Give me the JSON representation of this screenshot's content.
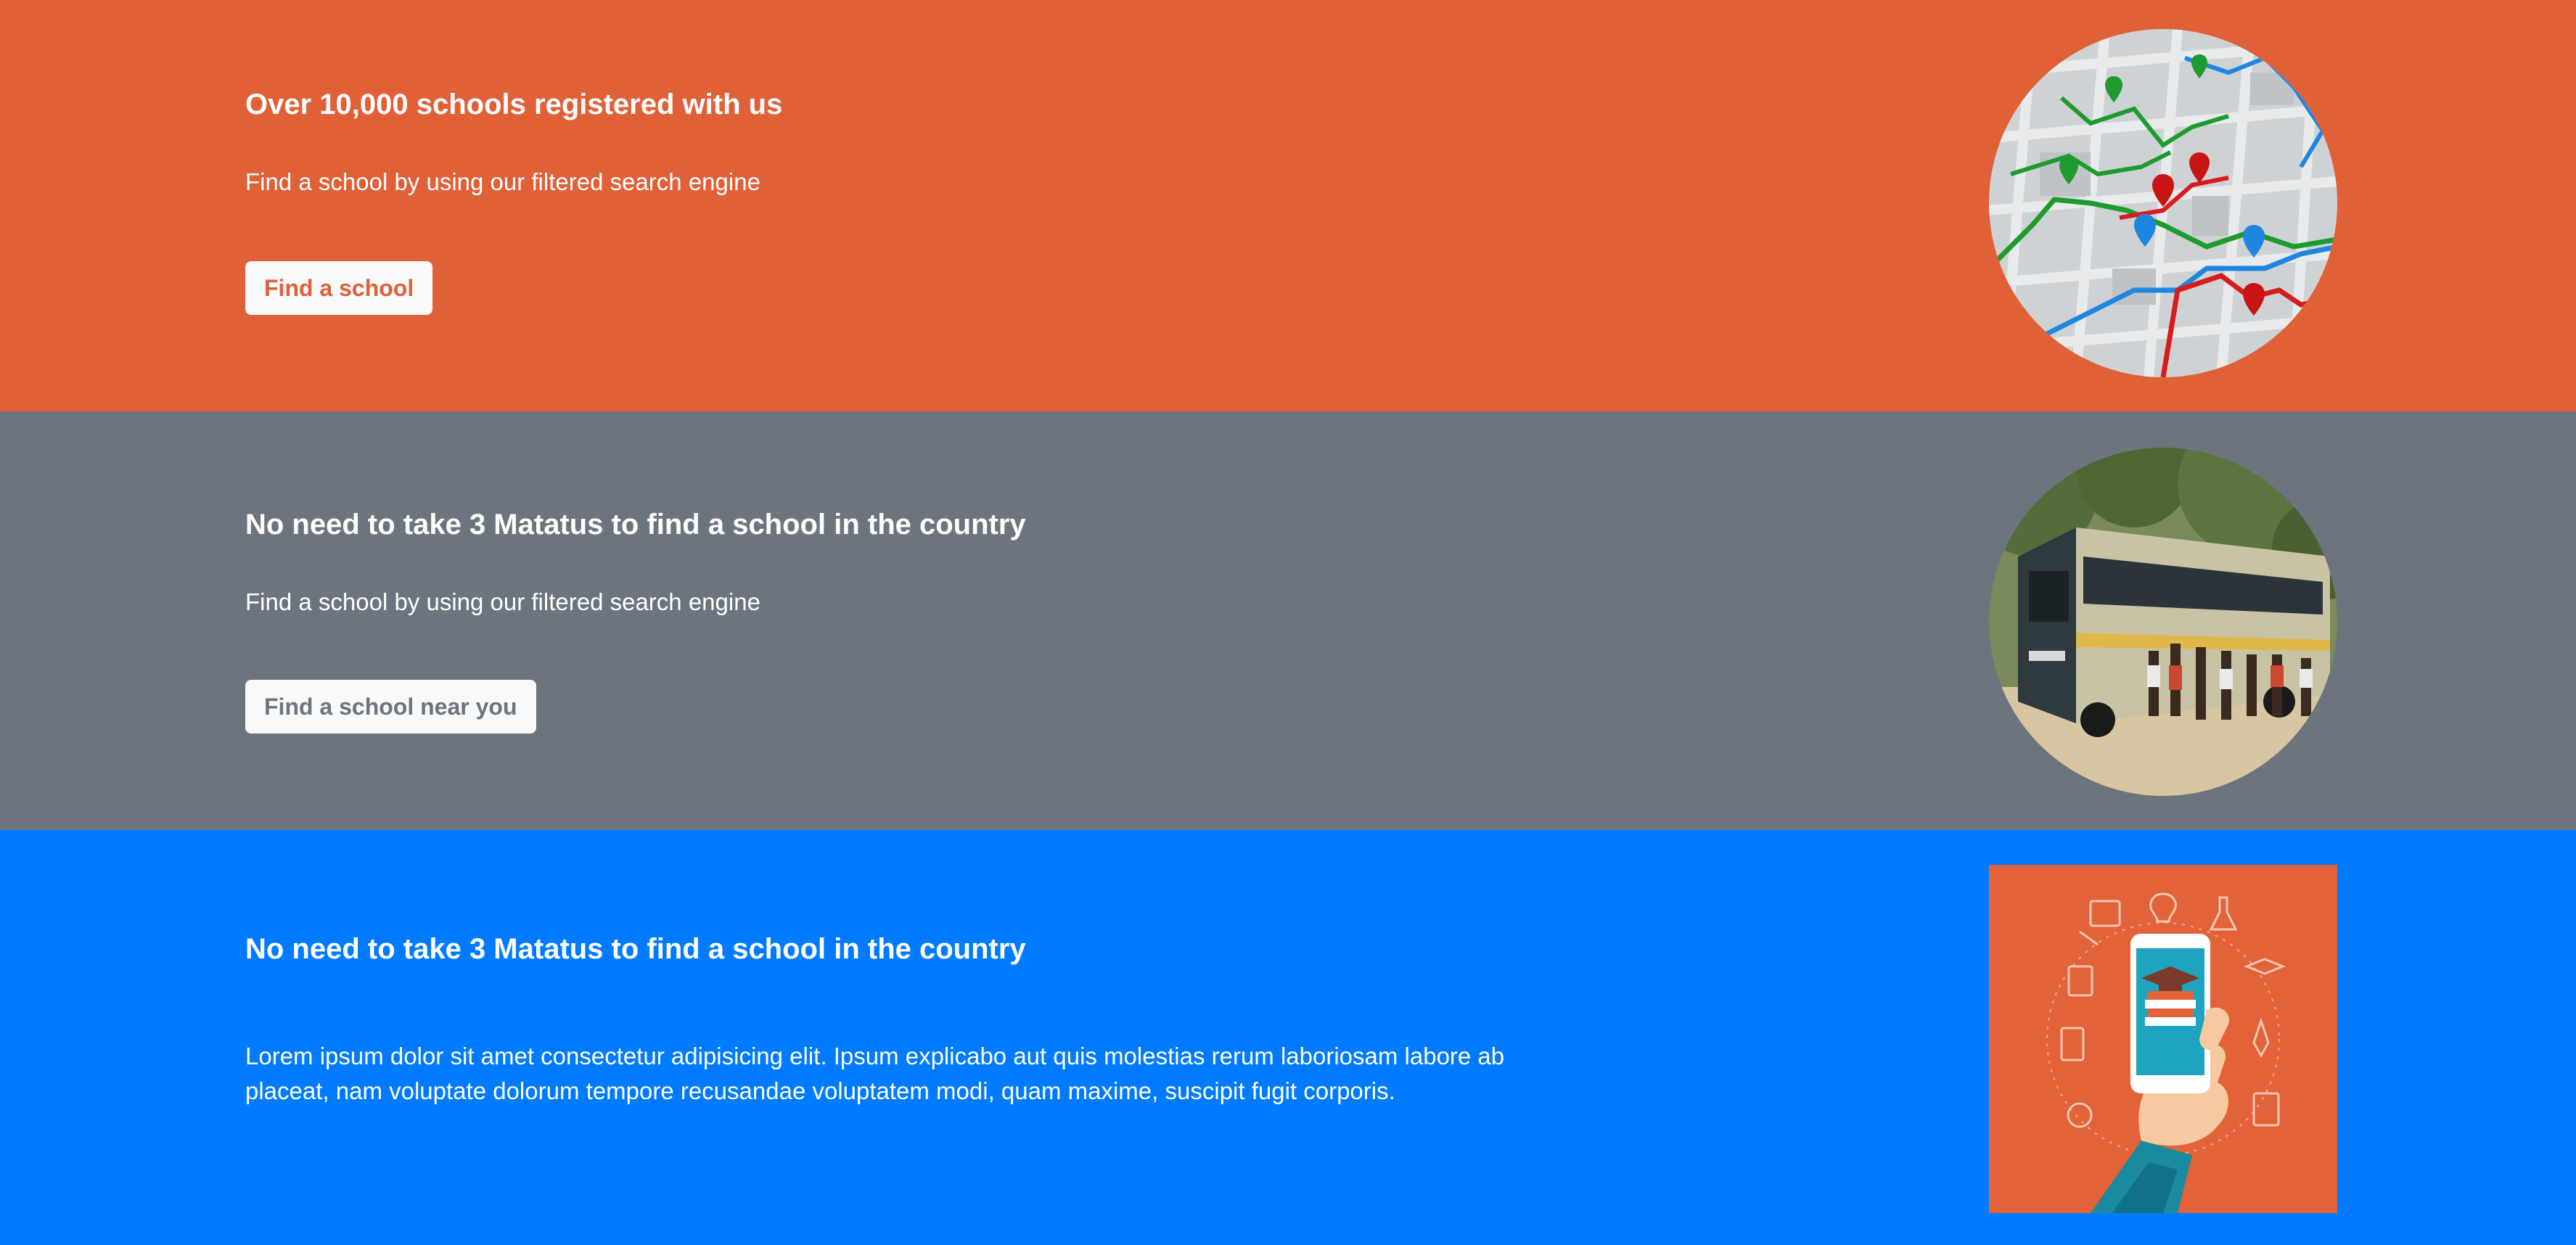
{
  "sections": [
    {
      "title": "Over 10,000 schools registered with us",
      "subtitle": "Find a school by using our filtered search engine",
      "button_label": "Find a school",
      "image": "map-route-image",
      "background": "#e06038",
      "button_text_color": "#e06038"
    },
    {
      "title": "No need to take 3 Matatus to find a school in the country",
      "subtitle": "Find a school by using our filtered search engine",
      "button_label": "Find a school near you",
      "image": "bus-crowd-image",
      "background": "#6c757d",
      "button_text_color": "#6c757d"
    },
    {
      "title": "No need to take 3 Matatus to find a school in the country",
      "paragraph": "Lorem ipsum dolor sit amet consectetur adipisicing elit. Ipsum explicabo aut quis molestias rerum laboriosam labore ab placeat, nam voluptate dolorum tempore recusandae voluptatem modi, quam maxime, suscipit fugit corporis.",
      "image": "mobile-learning-illustration",
      "background": "#007bff"
    }
  ]
}
